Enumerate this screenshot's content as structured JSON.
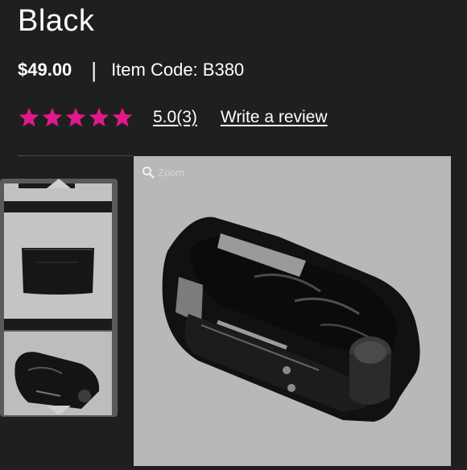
{
  "product": {
    "title": "Black",
    "price": "$49.00",
    "separator": "|",
    "item_code": "Item Code: B380"
  },
  "rating": {
    "stars": 5,
    "score": "5.0",
    "count": "(3)",
    "write_review": "Write a review",
    "star_color": "#e0198a"
  },
  "gallery": {
    "zoom_label": "Zoom",
    "thumbnails": [
      "organizer-thumbnail-1",
      "organizer-thumbnail-2",
      "organizer-thumbnail-3"
    ]
  },
  "icons": {
    "zoom": "magnifier-icon",
    "up": "chevron-up-icon",
    "down": "chevron-down-icon"
  }
}
